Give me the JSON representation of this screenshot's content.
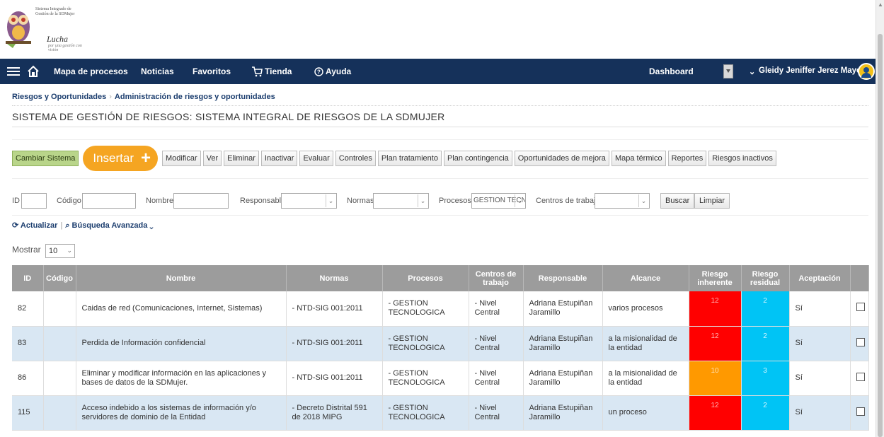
{
  "logo": {
    "system_text": "Sistema Integrado de Gestión de la SDMujer",
    "slogan": "Lucha",
    "slogan_sub": "por una gestión con visión"
  },
  "nav": {
    "items": [
      "Mapa de procesos",
      "Noticias",
      "Favoritos",
      "Tienda",
      "Ayuda"
    ],
    "dashboard": "Dashboard",
    "user": "Gleidy Jeniffer Jerez Mayorga"
  },
  "breadcrumb": [
    "Riesgos y Oportunidades",
    "Administración de riesgos y oportunidades"
  ],
  "page_title": "SISTEMA DE GESTIÓN DE RIESGOS: SISTEMA INTEGRAL DE RIESGOS DE LA SDMUJER",
  "toolbar": {
    "change_system": "Cambiar Sistema",
    "insert": "Insertar",
    "buttons": [
      "Modificar",
      "Ver",
      "Eliminar",
      "Inactivar",
      "Evaluar",
      "Controles",
      "Plan tratamiento",
      "Plan contingencia",
      "Oportunidades de mejora",
      "Mapa térmico",
      "Reportes",
      "Riesgos inactivos"
    ]
  },
  "filters": {
    "id_label": "ID",
    "codigo_label": "Código",
    "nombre_label": "Nombre",
    "responsable_label": "Responsable",
    "normas_label": "Normas",
    "procesos_label": "Procesos",
    "procesos_value": "GESTION TECN",
    "centros_label": "Centros de trabajo",
    "search": "Buscar",
    "clear": "Limpiar"
  },
  "actions": {
    "refresh": "Actualizar",
    "advanced": "Búsqueda Avanzada"
  },
  "paging": {
    "show_label": "Mostrar",
    "show_value": "10"
  },
  "colors": {
    "nav_bg": "#15315a",
    "insert": "#f5a522",
    "high": "#ff0000",
    "medium": "#ff9900",
    "low": "#00c4f5",
    "row_alt": "#d9e7f3"
  },
  "table": {
    "headers": [
      "ID",
      "Código",
      "Nombre",
      "Normas",
      "Procesos",
      "Centros de trabajo",
      "Responsable",
      "Alcance",
      "Riesgo inherente",
      "Riesgo residual",
      "Aceptación",
      ""
    ],
    "rows": [
      {
        "id": "82",
        "codigo": "",
        "nombre": "Caidas de red (Comunicaciones, Internet, Sistemas)",
        "normas": "- NTD-SIG 001:2011",
        "procesos": "- GESTION TECNOLOGICA",
        "centros": "- Nivel Central",
        "responsable": "Adriana Estupiñan Jaramillo",
        "alcance": "varios procesos",
        "inherente": "12",
        "residual": "2",
        "aceptacion": "Sí"
      },
      {
        "id": "83",
        "codigo": "",
        "nombre": "Perdida de Información confidencial",
        "normas": "- NTD-SIG 001:2011",
        "procesos": "- GESTION TECNOLOGICA",
        "centros": "- Nivel Central",
        "responsable": "Adriana Estupiñan Jaramillo",
        "alcance": "a la misionalidad de la entidad",
        "inherente": "12",
        "residual": "2",
        "aceptacion": "Sí"
      },
      {
        "id": "86",
        "codigo": "",
        "nombre": "Eliminar y modificar información en las aplicaciones y bases de datos de la SDMujer.",
        "normas": "- NTD-SIG 001:2011",
        "procesos": "- GESTION TECNOLOGICA",
        "centros": "- Nivel Central",
        "responsable": "Adriana Estupiñan Jaramillo",
        "alcance": "a la misionalidad de la entidad",
        "inherente": "10",
        "residual": "3",
        "aceptacion": "Sí"
      },
      {
        "id": "115",
        "codigo": "",
        "nombre": "Acceso indebido a los sistemas de información y/o servidores de dominio de la Entidad",
        "normas": "- Decreto Distrital 591 de 2018 MIPG",
        "procesos": "- GESTION TECNOLOGICA",
        "centros": "- Nivel Central",
        "responsable": "Adriana Estupiñan Jaramillo",
        "alcance": "un proceso",
        "inherente": "12",
        "residual": "2",
        "aceptacion": "Sí"
      }
    ]
  }
}
